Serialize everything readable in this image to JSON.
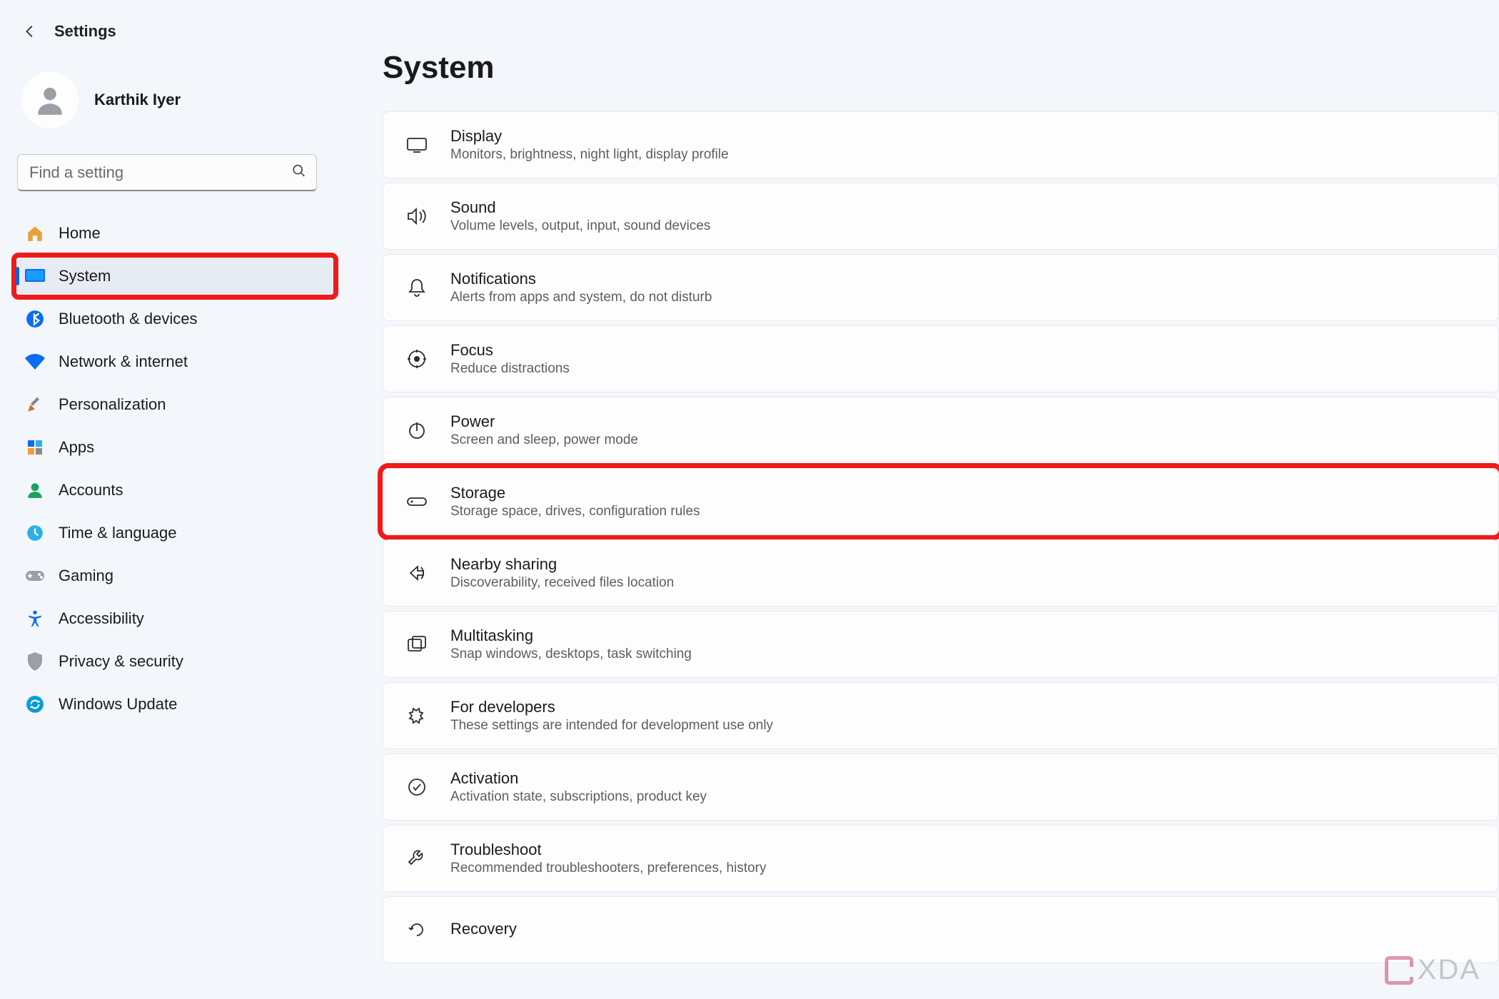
{
  "header": {
    "title": "Settings"
  },
  "user": {
    "name": "Karthik Iyer"
  },
  "search": {
    "placeholder": "Find a setting"
  },
  "page": {
    "title": "System"
  },
  "watermark": {
    "text": "XDA"
  },
  "nav": [
    {
      "key": "home",
      "label": "Home"
    },
    {
      "key": "system",
      "label": "System",
      "selected": true,
      "highlighted": true
    },
    {
      "key": "bluetooth",
      "label": "Bluetooth & devices"
    },
    {
      "key": "network",
      "label": "Network & internet"
    },
    {
      "key": "personalization",
      "label": "Personalization"
    },
    {
      "key": "apps",
      "label": "Apps"
    },
    {
      "key": "accounts",
      "label": "Accounts"
    },
    {
      "key": "time",
      "label": "Time & language"
    },
    {
      "key": "gaming",
      "label": "Gaming"
    },
    {
      "key": "accessibility",
      "label": "Accessibility"
    },
    {
      "key": "privacy",
      "label": "Privacy & security"
    },
    {
      "key": "update",
      "label": "Windows Update"
    }
  ],
  "cards": [
    {
      "key": "display",
      "title": "Display",
      "sub": "Monitors, brightness, night light, display profile"
    },
    {
      "key": "sound",
      "title": "Sound",
      "sub": "Volume levels, output, input, sound devices"
    },
    {
      "key": "notifications",
      "title": "Notifications",
      "sub": "Alerts from apps and system, do not disturb"
    },
    {
      "key": "focus",
      "title": "Focus",
      "sub": "Reduce distractions"
    },
    {
      "key": "power",
      "title": "Power",
      "sub": "Screen and sleep, power mode"
    },
    {
      "key": "storage",
      "title": "Storage",
      "sub": "Storage space, drives, configuration rules",
      "highlighted": true
    },
    {
      "key": "nearby",
      "title": "Nearby sharing",
      "sub": "Discoverability, received files location"
    },
    {
      "key": "multitasking",
      "title": "Multitasking",
      "sub": "Snap windows, desktops, task switching"
    },
    {
      "key": "developers",
      "title": "For developers",
      "sub": "These settings are intended for development use only"
    },
    {
      "key": "activation",
      "title": "Activation",
      "sub": "Activation state, subscriptions, product key"
    },
    {
      "key": "troubleshoot",
      "title": "Troubleshoot",
      "sub": "Recommended troubleshooters, preferences, history"
    },
    {
      "key": "recovery",
      "title": "Recovery",
      "sub": ""
    }
  ]
}
